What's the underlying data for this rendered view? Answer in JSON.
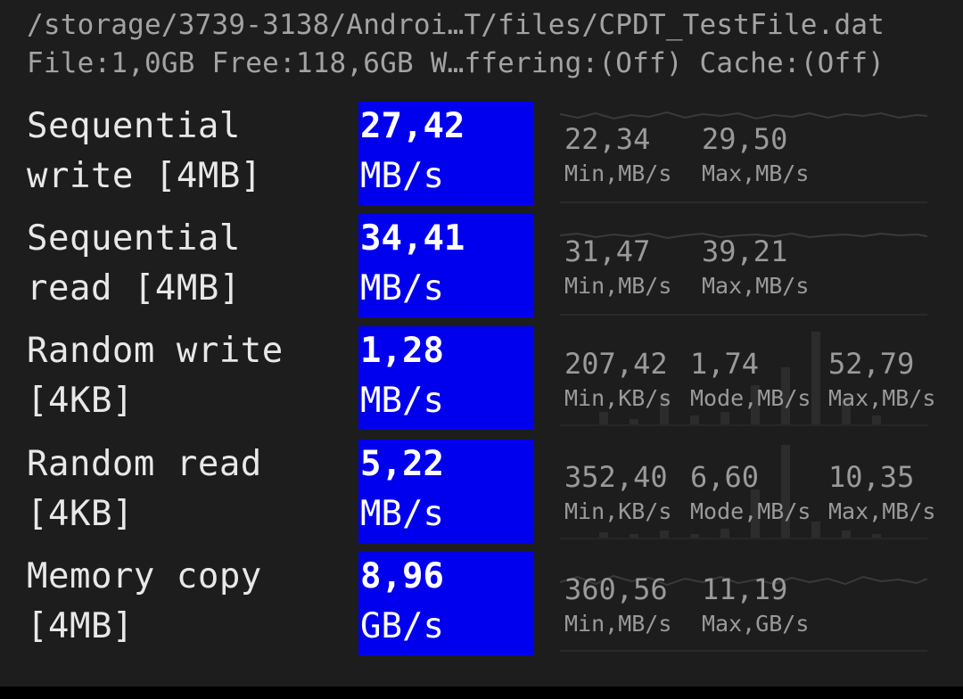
{
  "header": {
    "path": "/storage/3739-3138/Androi…T/files/CPDT_TestFile.dat",
    "info": "File:1,0GB Free:118,6GB W…ffering:(Off) Cache:(Off)"
  },
  "colors": {
    "result_bg": "#0000ee",
    "screen_bg": "#1d1d1d"
  },
  "tests": [
    {
      "name": "Sequential\nwrite [4MB]",
      "value": "27,42",
      "unit": "MB/s",
      "stats": [
        {
          "num": "22,34",
          "label": "Min,MB/s"
        },
        {
          "num": "29,50",
          "label": "Max,MB/s"
        }
      ]
    },
    {
      "name": "Sequential\nread [4MB]",
      "value": "34,41",
      "unit": "MB/s",
      "stats": [
        {
          "num": "31,47",
          "label": "Min,MB/s"
        },
        {
          "num": "39,21",
          "label": "Max,MB/s"
        }
      ]
    },
    {
      "name": "Random write\n[4KB]",
      "value": "1,28",
      "unit": "MB/s",
      "stats": [
        {
          "num": "207,42",
          "label": "Min,KB/s"
        },
        {
          "num": "1,74",
          "label": "Mode,MB/s"
        },
        {
          "num": "52,79",
          "label": "Max,MB/s"
        }
      ]
    },
    {
      "name": "Random read\n[4KB]",
      "value": "5,22",
      "unit": "MB/s",
      "stats": [
        {
          "num": "352,40",
          "label": "Min,KB/s"
        },
        {
          "num": "6,60",
          "label": "Mode,MB/s"
        },
        {
          "num": "10,35",
          "label": "Max,MB/s"
        }
      ]
    },
    {
      "name": "Memory copy\n[4MB]",
      "value": "8,96",
      "unit": "GB/s",
      "stats": [
        {
          "num": "360,56",
          "label": "Min,MB/s"
        },
        {
          "num": "11,19",
          "label": "Max,GB/s"
        }
      ]
    }
  ]
}
